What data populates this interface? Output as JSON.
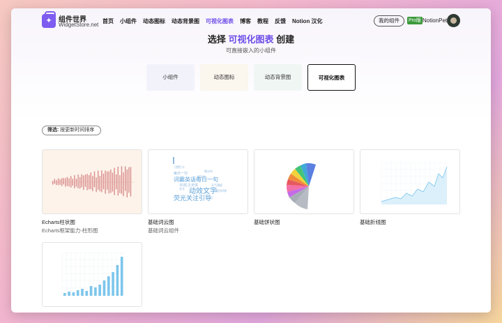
{
  "brand": {
    "title": "组件世界",
    "subtitle": "WidgetStore.net"
  },
  "nav": [
    "首页",
    "小组件",
    "动态图标",
    "动态背景图",
    "可视化图表",
    "博客",
    "教程",
    "反馈",
    "Notion 汉化"
  ],
  "nav_active_index": 4,
  "header": {
    "my_widgets": "我的组件",
    "pro_badge": "Pro版",
    "user_name": "NotionPet"
  },
  "hero": {
    "title_prefix": "选择 ",
    "title_highlight": "可视化图表",
    "title_suffix": " 创建",
    "subtitle": "可直接嵌入的小组件"
  },
  "categories": [
    {
      "label": "小组件"
    },
    {
      "label": "动态图标"
    },
    {
      "label": "动态背景图"
    },
    {
      "label": "可视化图表",
      "selected": true
    }
  ],
  "filter": {
    "label": "筛选:",
    "value": "按更新时间排序"
  },
  "cards": [
    {
      "title": "Echarts柱状图",
      "desc": "Echarts框架能力-柱形图"
    },
    {
      "title": "基础词云图",
      "desc": "基础词云组件"
    },
    {
      "title": "基础饼状图",
      "desc": ""
    },
    {
      "title": "基础折线图",
      "desc": ""
    },
    {
      "title": "",
      "desc": ""
    }
  ],
  "wordcloud_words": [
    "词霸英语每日一句",
    "动效文字",
    "荧光关注引导",
    "3D粒子天体",
    "每日一句",
    "倒计时",
    "天气预报",
    "名言",
    "翻页时钟",
    "番茄钟",
    "习惯打卡",
    "日历"
  ],
  "colors": {
    "accent": "#6d4de8",
    "pro": "#3c9a3c",
    "bar_red": "#d98c8c",
    "bar_blue": "#7cc6ec",
    "wordcloud": "#5aa0d8"
  }
}
